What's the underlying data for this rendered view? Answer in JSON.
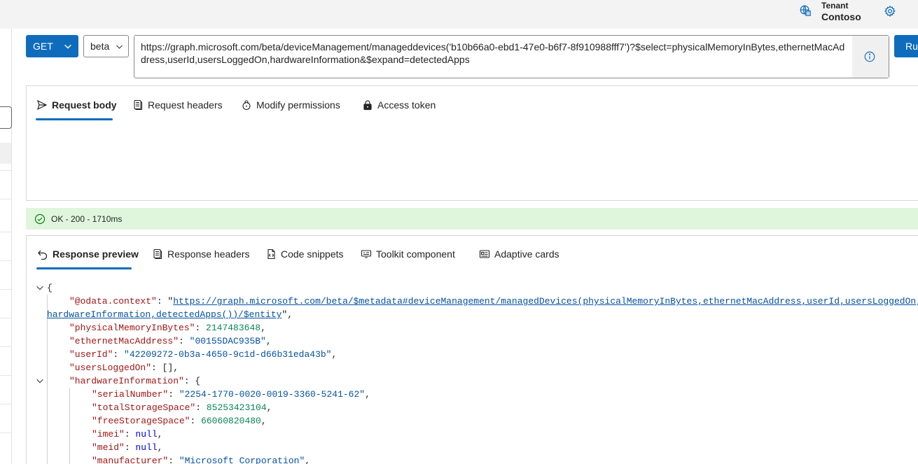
{
  "header": {
    "tenant_label": "Tenant",
    "tenant_name": "Contoso"
  },
  "query": {
    "method": "GET",
    "version": "beta",
    "url": "https://graph.microsoft.com/beta/deviceManagement/manageddevices('b10b66a0-ebd1-47e0-b6f7-8f910988fff7')?$select=physicalMemoryInBytes,ethernetMacAddress,userId,usersLoggedOn,hardwareInformation&$expand=detectedApps",
    "run_label": "Ru"
  },
  "request_tabs": [
    {
      "label": "Request body",
      "icon": "send-icon"
    },
    {
      "label": "Request headers",
      "icon": "document-icon"
    },
    {
      "label": "Modify permissions",
      "icon": "shield-lock-icon"
    },
    {
      "label": "Access token",
      "icon": "lock-icon"
    }
  ],
  "status": {
    "text": "OK - 200 - 1710ms",
    "color": "#dff6dd"
  },
  "response_tabs": [
    {
      "label": "Response preview",
      "icon": "undo-arrow-icon"
    },
    {
      "label": "Response headers",
      "icon": "document-icon"
    },
    {
      "label": "Code snippets",
      "icon": "code-document-icon"
    },
    {
      "label": "Toolkit component",
      "icon": "component-icon"
    },
    {
      "label": "Adaptive cards",
      "icon": "card-icon"
    }
  ],
  "json": {
    "open_brace": "{",
    "odata_key": "\"@odata.context\"",
    "odata_url_1": "https://graph.microsoft.com/beta/$metadata#deviceManagement/managedDevices(physicalMemoryInBytes,ethernetMacAddress,userId,usersLoggedOn,",
    "odata_url_2": "hardwareInformation,detectedApps())/$entity",
    "mem_key": "\"physicalMemoryInBytes\"",
    "mem_val": "2147483648",
    "mac_key": "\"ethernetMacAddress\"",
    "mac_val": "\"00155DAC935B\"",
    "uid_key": "\"userId\"",
    "uid_val": "\"42209272-0b3a-4650-9c1d-d66b31eda43b\"",
    "ulo_key": "\"usersLoggedOn\"",
    "ulo_val": "[]",
    "hw_key": "\"hardwareInformation\"",
    "sn_key": "\"serialNumber\"",
    "sn_val": "\"2254-1770-0020-0019-3360-5241-62\"",
    "tss_key": "\"totalStorageSpace\"",
    "tss_val": "85253423104",
    "fss_key": "\"freeStorageSpace\"",
    "fss_val": "66060820480",
    "imei_key": "\"imei\"",
    "null_val": "null",
    "meid_key": "\"meid\"",
    "mfr_key": "\"manufacturer\"",
    "mfr_val": "\"Microsoft Corporation\""
  }
}
